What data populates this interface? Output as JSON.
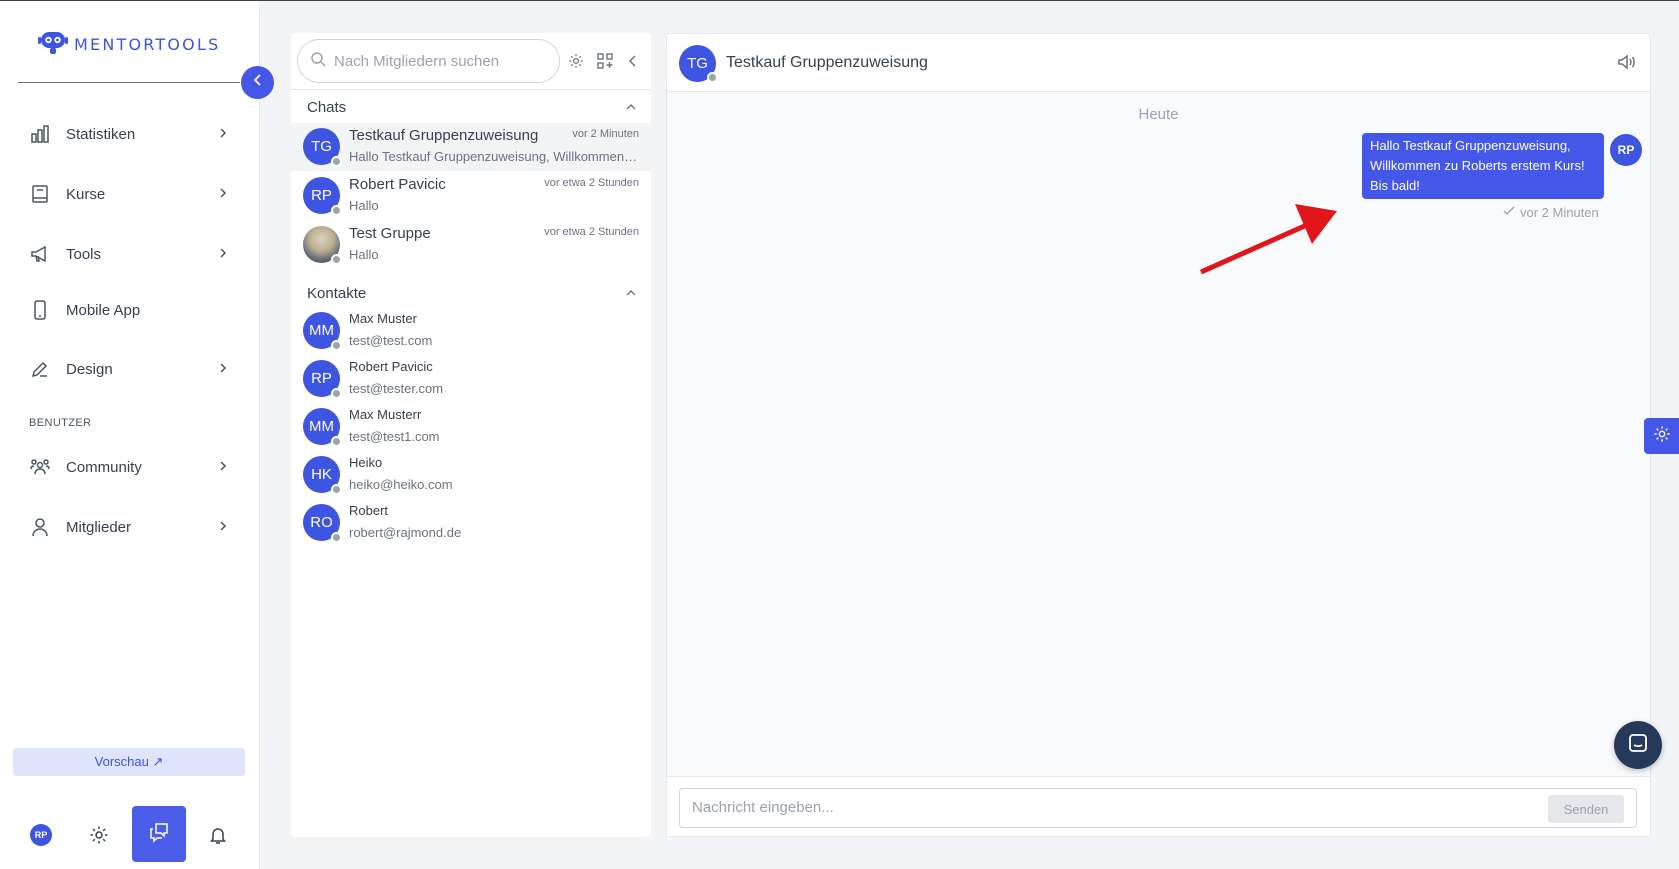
{
  "brand": {
    "name": "MENTORTOOLS"
  },
  "sidebar": {
    "items": [
      {
        "label": "Statistiken",
        "icon": "bar-chart-icon",
        "has_chevron": true
      },
      {
        "label": "Kurse",
        "icon": "book-icon",
        "has_chevron": true
      },
      {
        "label": "Tools",
        "icon": "megaphone-icon",
        "has_chevron": true
      },
      {
        "label": "Mobile App",
        "icon": "phone-icon",
        "has_chevron": false
      },
      {
        "label": "Design",
        "icon": "edit-icon",
        "has_chevron": true
      },
      {
        "label": "Community",
        "icon": "users-icon",
        "has_chevron": true
      },
      {
        "label": "Mitglieder",
        "icon": "user-icon",
        "has_chevron": true
      }
    ],
    "section_label": "BENUTZER",
    "preview_label": "Vorschau ↗",
    "user_initials": "RP"
  },
  "chatlist": {
    "search_placeholder": "Nach Mitgliedern suchen",
    "chats_label": "Chats",
    "contacts_label": "Kontakte",
    "chats": [
      {
        "initials": "TG",
        "name": "Testkauf Gruppenzuweisung",
        "preview": "Hallo Testkauf Gruppenzuweisung, Willkommen zu Roberts erstem Kurs! Bis bald!",
        "time": "vor 2 Minuten",
        "active": true
      },
      {
        "initials": "RP",
        "name": "Robert Pavicic",
        "preview": "Hallo",
        "time": "vor etwa 2 Stunden",
        "active": false
      },
      {
        "initials": "",
        "name": "Test Gruppe",
        "preview": "Hallo",
        "time": "vor etwa 2 Stunden",
        "active": false
      }
    ],
    "contacts": [
      {
        "initials": "MM",
        "name": "Max Muster",
        "email": "test@test.com"
      },
      {
        "initials": "RP",
        "name": "Robert Pavicic",
        "email": "test@tester.com"
      },
      {
        "initials": "MM",
        "name": "Max Musterr",
        "email": "test@test1.com"
      },
      {
        "initials": "HK",
        "name": "Heiko",
        "email": "heiko@heiko.com"
      },
      {
        "initials": "RO",
        "name": "Robert",
        "email": "robert@rajmond.de"
      }
    ]
  },
  "chat": {
    "initials": "TG",
    "title": "Testkauf Gruppenzuweisung",
    "day_label": "Heute",
    "message": {
      "lines": [
        "Hallo Testkauf Gruppenzuweisung,",
        "Willkommen zu Roberts erstem Kurs!",
        "Bis bald!"
      ],
      "sender_initials": "RP",
      "time": "vor 2 Minuten"
    },
    "composer_placeholder": "Nachricht eingeben...",
    "send_label": "Senden"
  },
  "colors": {
    "accent": "#4457e8",
    "brand": "#3d55e0",
    "annotation_arrow": "#e0161b",
    "fab": "#25395a"
  }
}
